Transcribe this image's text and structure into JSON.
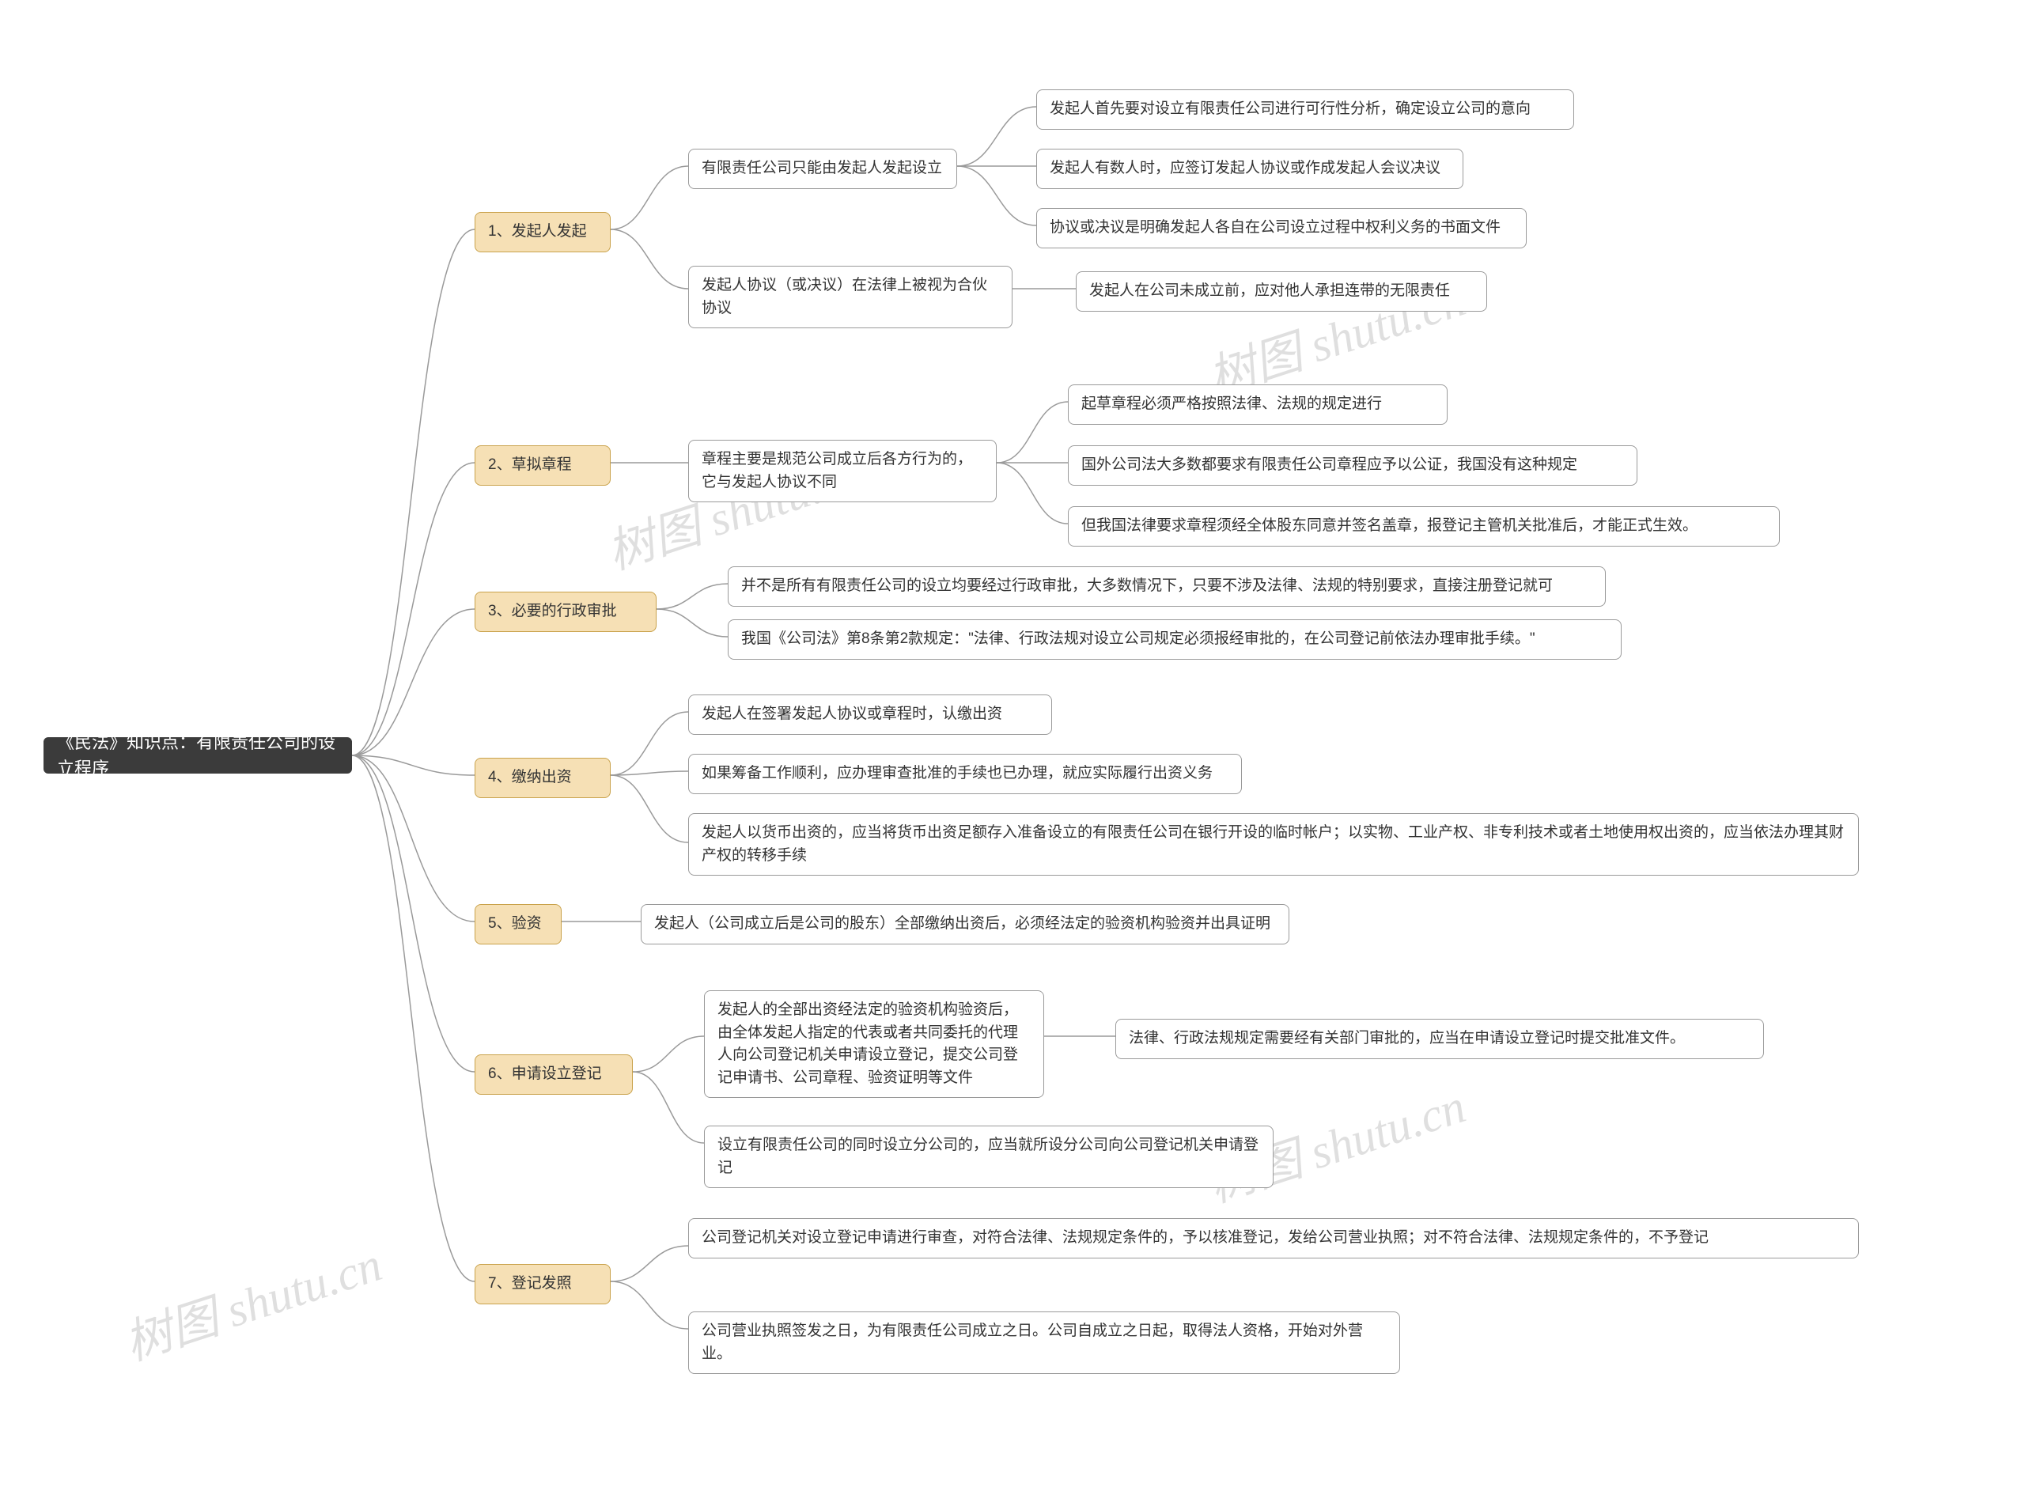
{
  "watermark_a": "树图 shutu.cn",
  "watermark_b": "树图 shutu.cn",
  "watermark_c": "树图 shutu.cn",
  "watermark_d": "树图 shutu.cn",
  "root": "《民法》知识点：有限责任公司的设立程序",
  "b1": {
    "title": "1、发起人发起",
    "n1": "有限责任公司只能由发起人发起设立",
    "n1a": "发起人首先要对设立有限责任公司进行可行性分析，确定设立公司的意向",
    "n1b": "发起人有数人时，应签订发起人协议或作成发起人会议决议",
    "n1c": "协议或决议是明确发起人各自在公司设立过程中权利义务的书面文件",
    "n2": "发起人协议（或决议）在法律上被视为合伙协议",
    "n2a": "发起人在公司未成立前，应对他人承担连带的无限责任"
  },
  "b2": {
    "title": "2、草拟章程",
    "n1": "章程主要是规范公司成立后各方行为的，它与发起人协议不同",
    "n1a": "起草章程必须严格按照法律、法规的规定进行",
    "n1b": "国外公司法大多数都要求有限责任公司章程应予以公证，我国没有这种规定",
    "n1c": "但我国法律要求章程须经全体股东同意并签名盖章，报登记主管机关批准后，才能正式生效。"
  },
  "b3": {
    "title": "3、必要的行政审批",
    "n1": "并不是所有有限责任公司的设立均要经过行政审批，大多数情况下，只要不涉及法律、法规的特别要求，直接注册登记就可",
    "n2": "我国《公司法》第8条第2款规定：\"法律、行政法规对设立公司规定必须报经审批的，在公司登记前依法办理审批手续。\""
  },
  "b4": {
    "title": "4、缴纳出资",
    "n1": "发起人在签署发起人协议或章程时，认缴出资",
    "n2": "如果筹备工作顺利，应办理审查批准的手续也已办理，就应实际履行出资义务",
    "n3": "发起人以货币出资的，应当将货币出资足额存入准备设立的有限责任公司在银行开设的临时帐户；以实物、工业产权、非专利技术或者土地使用权出资的，应当依法办理其财产权的转移手续"
  },
  "b5": {
    "title": "5、验资",
    "n1": "发起人（公司成立后是公司的股东）全部缴纳出资后，必须经法定的验资机构验资并出具证明"
  },
  "b6": {
    "title": "6、申请设立登记",
    "n1": "发起人的全部出资经法定的验资机构验资后，由全体发起人指定的代表或者共同委托的代理人向公司登记机关申请设立登记，提交公司登记申请书、公司章程、验资证明等文件",
    "n1a": "法律、行政法规规定需要经有关部门审批的，应当在申请设立登记时提交批准文件。",
    "n2": "设立有限责任公司的同时设立分公司的，应当就所设分公司向公司登记机关申请登记"
  },
  "b7": {
    "title": "7、登记发照",
    "n1": "公司登记机关对设立登记申请进行审查，对符合法律、法规规定条件的，予以核准登记，发给公司营业执照；对不符合法律、法规规定条件的，不予登记",
    "n2": "公司营业执照签发之日，为有限责任公司成立之日。公司自成立之日起，取得法人资格，开始对外营业。"
  }
}
